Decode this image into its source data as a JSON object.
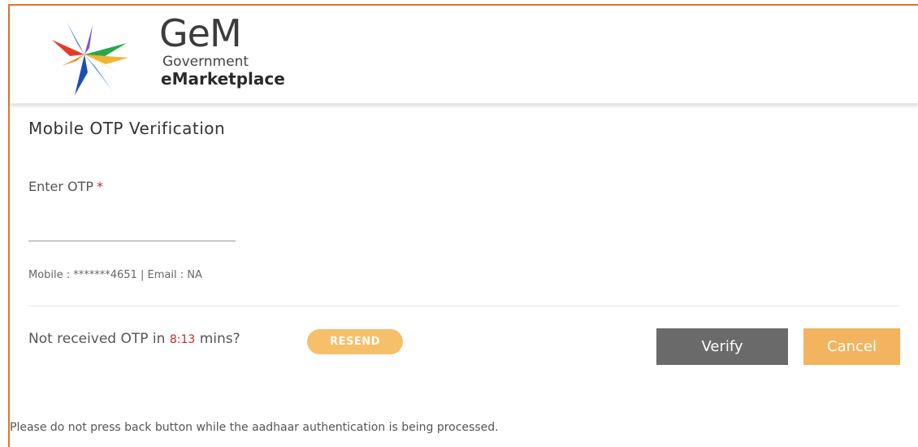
{
  "header": {
    "logo": {
      "brand": "GeM",
      "line1": "Government",
      "line2": "eMarketplace"
    }
  },
  "form": {
    "title": "Mobile OTP Verification",
    "otp_label": "Enter OTP",
    "required_marker": "*",
    "otp_value": "",
    "contact_info": "Mobile : *******4651 | Email : NA",
    "resend_prefix": "Not received OTP in",
    "timer": "8:13",
    "resend_suffix": "mins?",
    "resend_label": "RESEND",
    "verify_label": "Verify",
    "cancel_label": "Cancel"
  },
  "notice": "Please do not press back button while the aadhaar authentication is being processed.",
  "colors": {
    "frame": "#e4742b",
    "resend": "#f6bf6a",
    "verify": "#6a6a6a",
    "cancel": "#f2b45e",
    "timer": "#b03030"
  }
}
